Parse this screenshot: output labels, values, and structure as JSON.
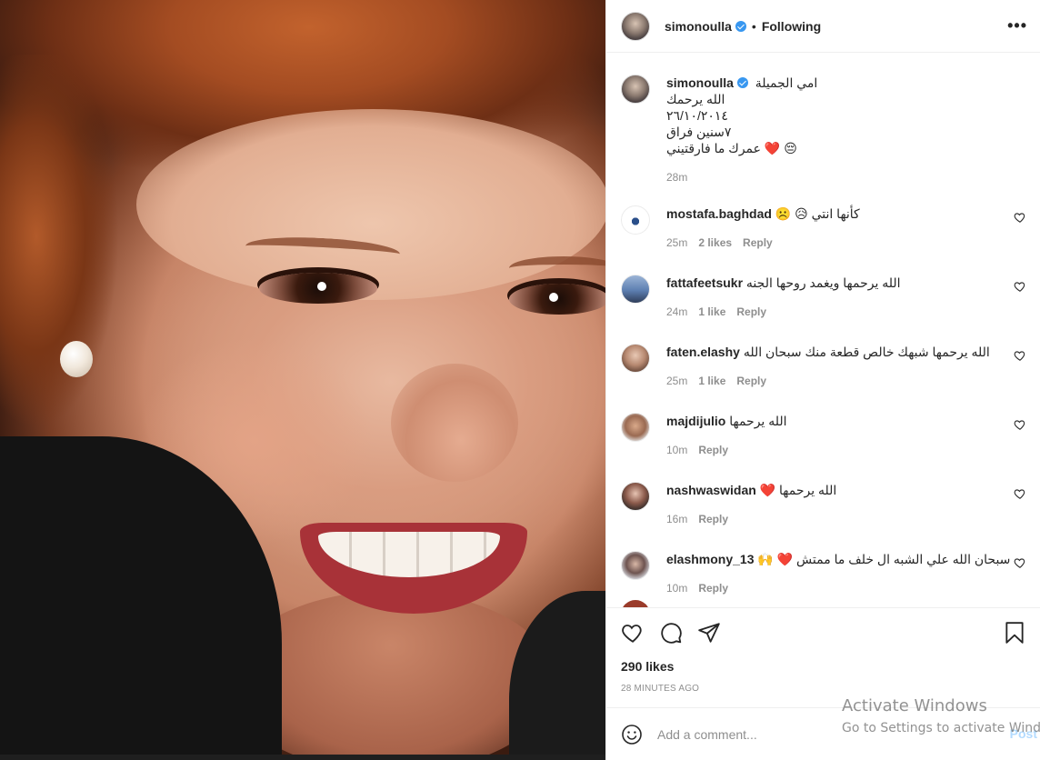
{
  "post": {
    "username": "simonoulla",
    "follow_status": "Following",
    "separator": "•",
    "more_label": "•••"
  },
  "caption": {
    "username": "simonoulla",
    "lines": [
      "امي الجميلة",
      "الله يرحمك",
      "٢٦/١٠/٢٠١٤",
      "٧سنين فراق",
      "😔 ❤️ عمرك ما فارقتيني"
    ],
    "time": "28m"
  },
  "comments": [
    {
      "username": "mostafa.baghdad",
      "text": "☹️ 😥 كأنها انتي",
      "time": "25m",
      "likes": "2 likes",
      "reply": "Reply"
    },
    {
      "username": "fattafeetsukr",
      "text": "الله يرحمها ويغمد روحها الجنه",
      "time": "24m",
      "likes": "1 like",
      "reply": "Reply"
    },
    {
      "username": "faten.elashy",
      "text": "الله يرحمها شبهك خالص قطعة منك سبحان الله",
      "time": "25m",
      "likes": "1 like",
      "reply": "Reply"
    },
    {
      "username": "majdijulio",
      "text": "الله يرحمها",
      "time": "10m",
      "likes": "",
      "reply": "Reply"
    },
    {
      "username": "nashwaswidan",
      "text": "❤️ الله يرحمها",
      "time": "16m",
      "likes": "",
      "reply": "Reply"
    },
    {
      "username": "elashmony_13",
      "text": "🙌 ❤️ سبحان الله علي الشبه ال خلف ما ممتش",
      "time": "10m",
      "likes": "",
      "reply": "Reply"
    }
  ],
  "stats": {
    "likes": "290 likes",
    "posted": "28 MINUTES AGO"
  },
  "add_comment": {
    "placeholder": "Add a comment...",
    "post_label": "Post"
  },
  "watermark": {
    "line1": "Activate Windows",
    "line2": "Go to Settings to activate Windows."
  },
  "colors": {
    "verified": "#3897f0",
    "heart": "#e0245e",
    "muted": "#8e8e8e",
    "post_disabled": "#b3dbff"
  },
  "icons": [
    "verified-badge-icon",
    "more-options-icon",
    "like-icon",
    "comment-icon",
    "share-icon",
    "save-icon",
    "emoji-icon",
    "comment-like-icon"
  ]
}
